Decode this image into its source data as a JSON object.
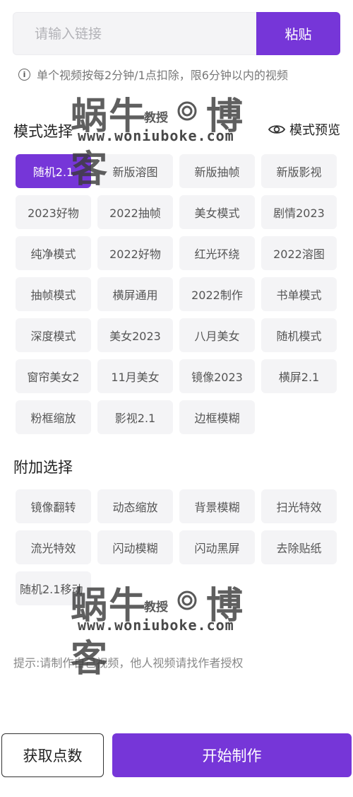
{
  "link_input": {
    "placeholder": "请输入链接",
    "paste_label": "粘贴"
  },
  "notice": {
    "text": "单个视频按每2分钟/1点扣除，限6分钟以内的视频"
  },
  "mode_section": {
    "title": "模式选择",
    "preview_label": "模式预览",
    "options": [
      "随机2.1",
      "新版溶图",
      "新版抽帧",
      "新版影视",
      "2023好物",
      "2022抽帧",
      "美女模式",
      "剧情2023",
      "纯净模式",
      "2022好物",
      "红光环绕",
      "2022溶图",
      "抽帧模式",
      "横屏通用",
      "2022制作",
      "书单模式",
      "深度模式",
      "美女2023",
      "八月美女",
      "随机模式",
      "窗帘美女2",
      "11月美女",
      "镜像2023",
      "横屏2.1",
      "粉框缩放",
      "影视2.1",
      "边框模糊"
    ],
    "selected": "随机2.1"
  },
  "extra_section": {
    "title": "附加选择",
    "options": [
      "镜像翻转",
      "动态缩放",
      "背景模糊",
      "扫光特效",
      "流光特效",
      "闪动模糊",
      "闪动黑屏",
      "去除贴纸",
      "随机2.1移动"
    ]
  },
  "hint": {
    "text": "提示:请制作自己视频，他人视频请找作者授权"
  },
  "watermark": {
    "main": "蜗牛",
    "small": "教授",
    "brand": "博客",
    "url": "www.woniuboke.com"
  },
  "actions": {
    "points_label": "获取点数",
    "start_label": "开始制作"
  },
  "colors": {
    "accent": "#7636d8",
    "chip_bg": "#f4f4f6"
  }
}
